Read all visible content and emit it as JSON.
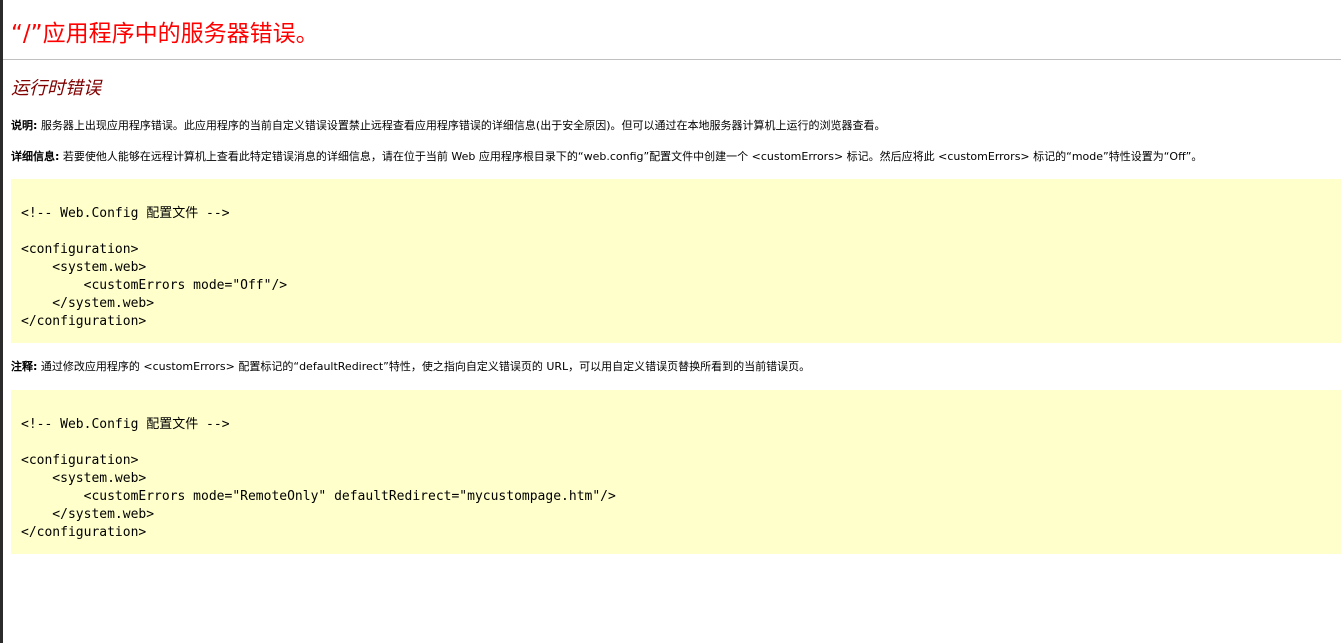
{
  "error_page": {
    "title": "“/”应用程序中的服务器错误。",
    "subtitle": "运行时错误",
    "description_label": "说明:",
    "description_text": " 服务器上出现应用程序错误。此应用程序的当前自定义错误设置禁止远程查看应用程序错误的详细信息(出于安全原因)。但可以通过在本地服务器计算机上运行的浏览器查看。",
    "details_label": "详细信息:",
    "details_text": " 若要使他人能够在远程计算机上查看此特定错误消息的详细信息，请在位于当前 Web 应用程序根目录下的“web.config”配置文件中创建一个 <customErrors> 标记。然后应将此 <customErrors> 标记的“mode”特性设置为“Off”。",
    "code_block_1": "<!-- Web.Config 配置文件 -->\n\n<configuration>\n    <system.web>\n        <customErrors mode=\"Off\"/>\n    </system.web>\n</configuration>",
    "notes_label": "注释:",
    "notes_text": " 通过修改应用程序的 <customErrors> 配置标记的“defaultRedirect”特性，使之指向自定义错误页的 URL，可以用自定义错误页替换所看到的当前错误页。",
    "code_block_2": "<!-- Web.Config 配置文件 -->\n\n<configuration>\n    <system.web>\n        <customErrors mode=\"RemoteOnly\" defaultRedirect=\"mycustompage.htm\"/>\n    </system.web>\n</configuration>"
  },
  "colors": {
    "title": "#ff0000",
    "subtitle": "#800000",
    "code_background": "#ffffcc"
  }
}
